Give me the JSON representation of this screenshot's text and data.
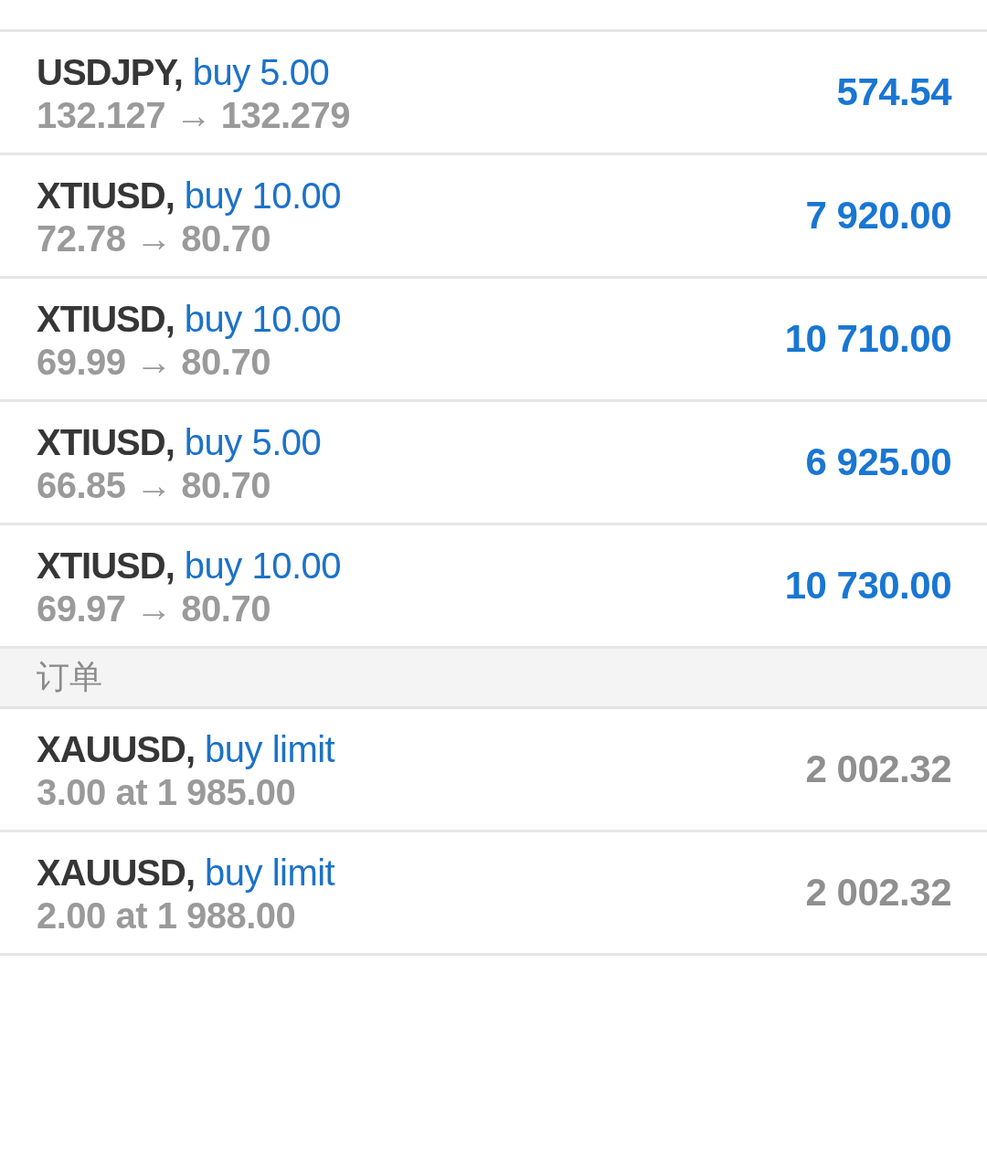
{
  "positions": [
    {
      "symbol": "USDJPY,",
      "order": "buy 5.00",
      "prices": "**132.127** → **132.279**",
      "profit": "574.54"
    },
    {
      "symbol": "XTIUSD,",
      "order": "buy 10.00",
      "prices": "**72.78** → **80.70**",
      "profit": "7 920.00"
    },
    {
      "symbol": "XTIUSD,",
      "order": "buy 10.00",
      "prices": "**69.99** → **80.70**",
      "profit": "10 710.00"
    },
    {
      "symbol": "XTIUSD,",
      "order": "buy 5.00",
      "prices": "**66.85** → **80.70**",
      "profit": "6 925.00"
    },
    {
      "symbol": "XTIUSD,",
      "order": "buy 10.00",
      "prices": "**69.97** → **80.70**",
      "profit": "10 730.00"
    }
  ],
  "orders": {
    "title": "订单",
    "items": [
      {
        "symbol": "XAUUSD,",
        "order": "buy limit",
        "details": "3.00 at 1 985.00",
        "price": "2 002.32"
      },
      {
        "symbol": "XAUUSD,",
        "order": "buy limit",
        "details": "2.00 at 1 988.00",
        "price": "2 002.32"
      }
    ]
  }
}
